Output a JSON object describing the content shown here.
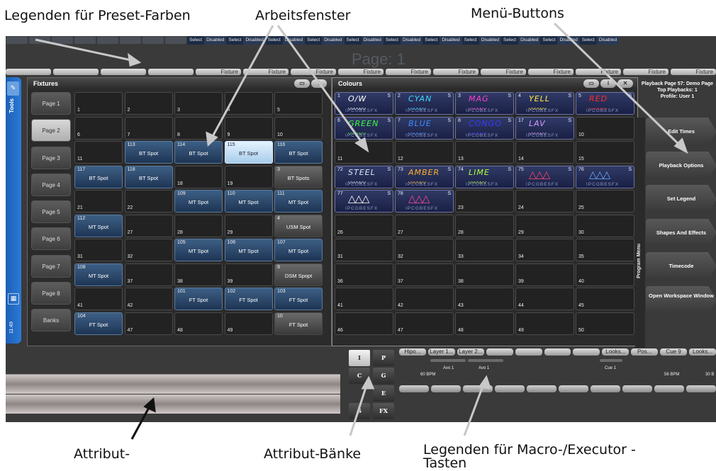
{
  "annotations": {
    "preset_legends": "Legenden für Preset-Farben",
    "workspace": "Arbeitsfenster",
    "menu_buttons": "Menü-Buttons",
    "attribute": "Attribut-",
    "attribute_banks": "Attribut-Bänke",
    "macro_legends_l1": "Legenden für Macro-/Executor -",
    "macro_legends_l2": "Tasten"
  },
  "top": {
    "select": "Select",
    "disabled": "Disabled",
    "page_label": "Page: 1",
    "fixture_label": "Fixture"
  },
  "tools": {
    "label": "Tools",
    "time": "11:49"
  },
  "fixtures": {
    "title": "Fixtures",
    "pages": [
      "Page 1",
      "Page 2",
      "Page 3",
      "Page 4",
      "Page 5",
      "Page 6",
      "Page 7",
      "Page 8",
      "Banks"
    ],
    "selected_page": "Page 2",
    "cells": [
      {
        "n": "1"
      },
      {
        "n": "2"
      },
      {
        "n": "3"
      },
      {
        "n": "4"
      },
      {
        "n": "5"
      },
      {
        "n": "6"
      },
      {
        "n": "7"
      },
      {
        "n": "8"
      },
      {
        "n": "9"
      },
      {
        "n": "10"
      },
      {
        "n": "11"
      },
      {
        "n": "113",
        "l": "BT Spot",
        "s": "blue"
      },
      {
        "n": "114",
        "l": "BT Spot",
        "s": "blue"
      },
      {
        "n": "115",
        "l": "BT Spot",
        "s": "light"
      },
      {
        "n": "116",
        "l": "BT Spot",
        "s": "blue"
      },
      {
        "n": "117",
        "l": "BT Spot",
        "s": "blue"
      },
      {
        "n": "118",
        "l": "BT Spot",
        "s": "blue"
      },
      {
        "n": "18"
      },
      {
        "n": "19"
      },
      {
        "n": "3",
        "l": "BT Spots",
        "s": "grey"
      },
      {
        "n": "21"
      },
      {
        "n": "22"
      },
      {
        "n": "109",
        "l": "MT Spot",
        "s": "blue"
      },
      {
        "n": "110",
        "l": "MT Spot",
        "s": "blue"
      },
      {
        "n": "111",
        "l": "MT Spot",
        "s": "blue"
      },
      {
        "n": "112",
        "l": "MT Spot",
        "s": "blue"
      },
      {
        "n": "27"
      },
      {
        "n": "28"
      },
      {
        "n": "29"
      },
      {
        "n": "4",
        "l": "USM Spot",
        "s": "grey"
      },
      {
        "n": "31"
      },
      {
        "n": "32"
      },
      {
        "n": "105",
        "l": "MT Spot",
        "s": "blue"
      },
      {
        "n": "106",
        "l": "MT Spot",
        "s": "blue"
      },
      {
        "n": "107",
        "l": "MT Spot",
        "s": "blue"
      },
      {
        "n": "108",
        "l": "MT Spot",
        "s": "blue"
      },
      {
        "n": "37"
      },
      {
        "n": "38"
      },
      {
        "n": "39"
      },
      {
        "n": "9",
        "l": "DSM Spopt",
        "s": "grey"
      },
      {
        "n": "41"
      },
      {
        "n": "42"
      },
      {
        "n": "101",
        "l": "FT Spot",
        "s": "blue"
      },
      {
        "n": "102",
        "l": "FT Spot",
        "s": "blue"
      },
      {
        "n": "103",
        "l": "FT Spot",
        "s": "blue"
      },
      {
        "n": "104",
        "l": "FT Spot",
        "s": "blue"
      },
      {
        "n": "47"
      },
      {
        "n": "48"
      },
      {
        "n": "49"
      },
      {
        "n": "10",
        "l": "FT Spot",
        "s": "grey"
      }
    ]
  },
  "colours": {
    "title": "Colours",
    "attrs": "IPCGBESFX",
    "cells": [
      {
        "n": "1",
        "name": "O/W",
        "c": "#ffffff",
        "p": true
      },
      {
        "n": "2",
        "name": "CYAN",
        "c": "#3fd8ff",
        "p": true
      },
      {
        "n": "3",
        "name": "MAG",
        "c": "#ff3fd2",
        "p": true
      },
      {
        "n": "4",
        "name": "YELL",
        "c": "#ffee3a",
        "p": true
      },
      {
        "n": "5",
        "name": "RED",
        "c": "#ff2a2a",
        "p": true
      },
      {
        "n": "6",
        "name": "GREEN",
        "c": "#3cff3c",
        "p": true
      },
      {
        "n": "7",
        "name": "BLUE",
        "c": "#3a8cff",
        "p": true
      },
      {
        "n": "8",
        "name": "CONGO",
        "c": "#3a3aff",
        "p": true
      },
      {
        "n": "17",
        "name": "LAV",
        "c": "#d89cff",
        "p": true
      },
      {
        "n": "10"
      },
      {
        "n": "11"
      },
      {
        "n": "12"
      },
      {
        "n": "13"
      },
      {
        "n": "14"
      },
      {
        "n": "15"
      },
      {
        "n": "72",
        "name": "STEEL",
        "c": "#d9e6f5",
        "p": true
      },
      {
        "n": "73",
        "name": "AMBER",
        "c": "#ffb02a",
        "p": true
      },
      {
        "n": "74",
        "name": "LIME",
        "c": "#b6ff3a",
        "p": true
      },
      {
        "n": "75",
        "name": "",
        "c": "#ff4a6a",
        "p": true
      },
      {
        "n": "76",
        "name": "",
        "c": "#6ab0ff",
        "p": true
      },
      {
        "n": "77",
        "name": "",
        "c": "#ffffff",
        "p": true
      },
      {
        "n": "78",
        "name": "",
        "c": "#ff4aa0",
        "p": true
      },
      {
        "n": "23"
      },
      {
        "n": "24"
      },
      {
        "n": "25"
      },
      {
        "n": "26"
      },
      {
        "n": "27"
      },
      {
        "n": "28"
      },
      {
        "n": "29"
      },
      {
        "n": "30"
      },
      {
        "n": "31"
      },
      {
        "n": "32"
      },
      {
        "n": "33"
      },
      {
        "n": "34"
      },
      {
        "n": "35"
      },
      {
        "n": "36"
      },
      {
        "n": "37"
      },
      {
        "n": "38"
      },
      {
        "n": "39"
      },
      {
        "n": "40"
      },
      {
        "n": "41"
      },
      {
        "n": "42"
      },
      {
        "n": "43"
      },
      {
        "n": "44"
      },
      {
        "n": "45"
      },
      {
        "n": "46"
      },
      {
        "n": "47"
      },
      {
        "n": "48"
      },
      {
        "n": "49"
      },
      {
        "n": "50"
      }
    ]
  },
  "playback_info": {
    "line1": "Playback Page 57: Demo Page",
    "line2": "Top Playbacks: 1",
    "line3": "Profile: User 1"
  },
  "program_menu": {
    "label": "Program Menu",
    "buttons": [
      "Edit Times",
      "Playback Options",
      "Set Legend",
      "Shapes And Effects",
      "Timecode",
      "Open Workspace Window"
    ]
  },
  "banks": [
    "I",
    "P",
    "C",
    "G",
    "",
    "E",
    "S",
    "FX"
  ],
  "macro_keys": [
    "Hipo...",
    "Layer 1...",
    "Layer 2...",
    "",
    "",
    "",
    "",
    "Looks...",
    "Pos...",
    "Cue 9",
    "Looks..."
  ],
  "executors": {
    "bpm1": "60 BPM",
    "avo1": "Avo 1",
    "avo2": "Avo 1",
    "cue1": "Cue 1",
    "bpm2": "56 BPM",
    "bpm3": "30 B"
  }
}
